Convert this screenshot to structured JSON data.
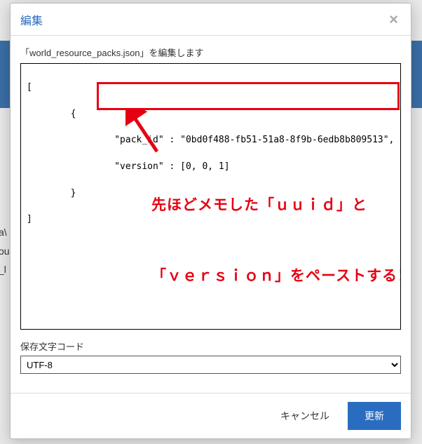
{
  "bg_lines": [
    "a\\",
    "ou",
    "_l"
  ],
  "modal": {
    "title": "編集",
    "close_glyph": "×",
    "edit_label": "「world_resource_packs.json」を編集します",
    "code": {
      "l1": "[",
      "l2": "        {",
      "l3": "                \"pack_id\" : \"0bd0f488-fb51-51a8-8f9b-6edb8b809513\",",
      "l4": "                \"version\" : [0, 0, 1]",
      "l5": "        }",
      "l6": "]"
    },
    "callout_line1": "先ほどメモした「ｕｕｉｄ」と",
    "callout_line2": "「ｖｅｒｓｉｏｎ」をペーストする！",
    "encoding_label": "保存文字コード",
    "encoding_value": "UTF-8",
    "cancel_label": "キャンセル",
    "submit_label": "更新"
  }
}
